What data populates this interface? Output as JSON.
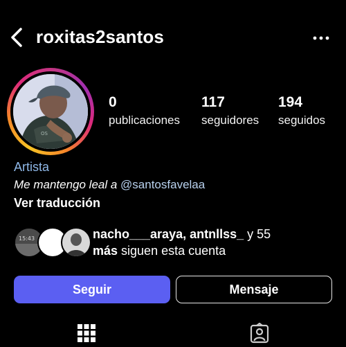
{
  "header": {
    "username": "roxitas2santos"
  },
  "profile": {
    "stats": [
      {
        "value": "0",
        "label": "publicaciones"
      },
      {
        "value": "117",
        "label": "seguidores"
      },
      {
        "value": "194",
        "label": "seguidos"
      }
    ],
    "category": "Artista",
    "bio_text": "Me mantengo leal a ",
    "bio_mention": "@santosfavelaa",
    "translate_label": "Ver traducción"
  },
  "followed_by": {
    "names": "nacho___araya, antnllss_",
    "connector": " y 55",
    "more": "más",
    "suffix": " siguen esta cuenta",
    "avatar_time": "15:43"
  },
  "actions": {
    "follow_label": "Seguir",
    "message_label": "Mensaje"
  },
  "colors": {
    "accent_button": "#5b5ff2",
    "category": "#8fb8e8",
    "mention": "#b9d2ef"
  },
  "icons": {
    "back": "chevron-left-icon",
    "more": "ellipsis-icon",
    "grid": "grid-icon",
    "tagged": "tagged-person-icon"
  }
}
